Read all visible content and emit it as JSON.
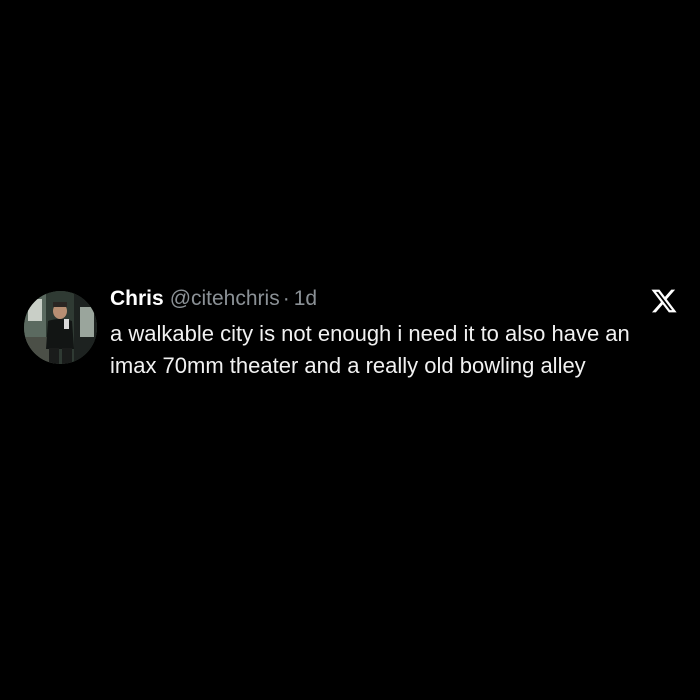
{
  "tweet": {
    "author_name": "Chris",
    "author_handle": "@citehchris",
    "separator": "·",
    "time": "1d",
    "text": "a walkable city is not enough i need it to also have an imax 70mm theater and a really old bowling alley"
  },
  "icons": {
    "platform_logo": "x-logo-icon",
    "avatar": "user-avatar-photo"
  },
  "colors": {
    "background": "#000000",
    "name": "#ffffff",
    "meta": "#8b9196",
    "text": "#f1f1f1"
  }
}
